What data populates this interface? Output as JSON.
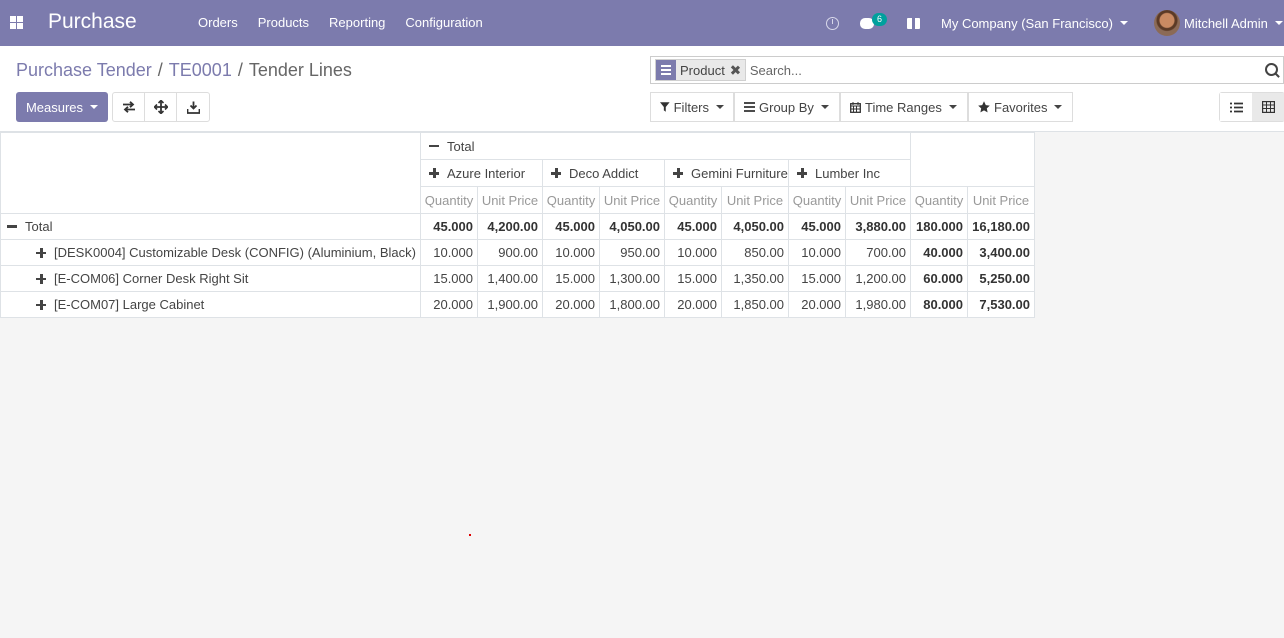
{
  "navbar": {
    "app_name": "Purchase",
    "menu": [
      "Orders",
      "Products",
      "Reporting",
      "Configuration"
    ],
    "chat_count": "6",
    "company": "My Company (San Francisco)",
    "user": "Mitchell Admin",
    "bg_color": "#7c7bad",
    "icons": [
      "apps-icon",
      "clock-icon",
      "chat-icon",
      "gift-icon"
    ]
  },
  "breadcrumb": {
    "items": [
      "Purchase Tender",
      "TE0001"
    ],
    "current": "Tender Lines"
  },
  "search": {
    "facet_label": "Product",
    "placeholder": "Search..."
  },
  "toolbar": {
    "measures_label": "Measures",
    "filters_label": "Filters",
    "groupby_label": "Group By",
    "timeranges_label": "Time Ranges",
    "favorites_label": "Favorites"
  },
  "pivot": {
    "col_total_label": "Total",
    "col_groups": [
      "Azure Interior",
      "Deco Addict",
      "Gemini Furniture",
      "Lumber Inc"
    ],
    "measures": [
      "Quantity",
      "Unit Price"
    ],
    "row_total_label": "Total",
    "total_row": [
      "45.000",
      "4,200.00",
      "45.000",
      "4,050.00",
      "45.000",
      "4,050.00",
      "45.000",
      "3,880.00",
      "180.000",
      "16,180.00"
    ],
    "rows": [
      {
        "label": "[DESK0004] Customizable Desk (CONFIG) (Aluminium, Black)",
        "values": [
          "10.000",
          "900.00",
          "10.000",
          "950.00",
          "10.000",
          "850.00",
          "10.000",
          "700.00",
          "40.000",
          "3,400.00"
        ]
      },
      {
        "label": "[E-COM06] Corner Desk Right Sit",
        "values": [
          "15.000",
          "1,400.00",
          "15.000",
          "1,300.00",
          "15.000",
          "1,350.00",
          "15.000",
          "1,200.00",
          "60.000",
          "5,250.00"
        ]
      },
      {
        "label": "[E-COM07] Large Cabinet",
        "values": [
          "20.000",
          "1,900.00",
          "20.000",
          "1,800.00",
          "20.000",
          "1,850.00",
          "20.000",
          "1,980.00",
          "80.000",
          "7,530.00"
        ]
      }
    ]
  }
}
